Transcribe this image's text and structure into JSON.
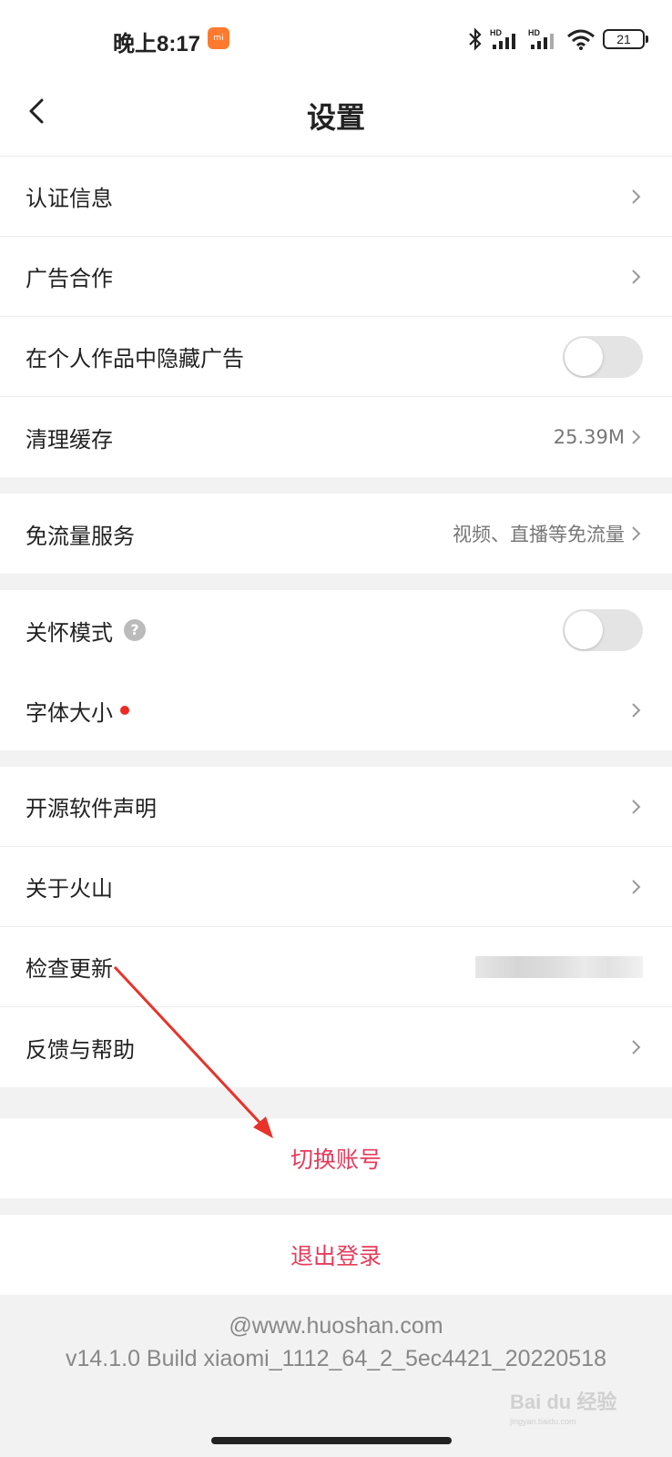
{
  "status": {
    "time": "晚上8:17",
    "battery": "21",
    "icons": [
      "bluetooth-icon",
      "signal-hd-icon",
      "signal-hd-icon",
      "wifi-icon",
      "battery-icon"
    ]
  },
  "nav": {
    "title": "设置",
    "back_icon": "chevron-left-icon"
  },
  "groups": {
    "g1": {
      "auth": "认证信息",
      "ad_coop": "广告合作",
      "hide_ads": "在个人作品中隐藏广告",
      "hide_ads_on": false,
      "clear_cache": "清理缓存",
      "cache_size": "25.39M"
    },
    "g2": {
      "free_data": "免流量服务",
      "free_data_desc": "视频、直播等免流量"
    },
    "g3": {
      "care_mode": "关怀模式",
      "care_mode_help": "?",
      "care_mode_on": false,
      "font_size": "字体大小"
    },
    "g4": {
      "open_source": "开源软件声明",
      "about": "关于火山",
      "check_update": "检查更新",
      "feedback": "反馈与帮助"
    }
  },
  "actions": {
    "switch_account": "切换账号",
    "logout": "退出登录"
  },
  "footer": {
    "domain": "@www.huoshan.com",
    "version": "v14.1.0 Build xiaomi_1112_64_2_5ec4421_20220518"
  },
  "watermark": {
    "brand": "Bai du 经验",
    "url": "jingyan.baidu.com"
  },
  "colors": {
    "accent": "#e63c5c",
    "annotation_arrow": "#e8322a",
    "dot": "#ee2a24"
  }
}
